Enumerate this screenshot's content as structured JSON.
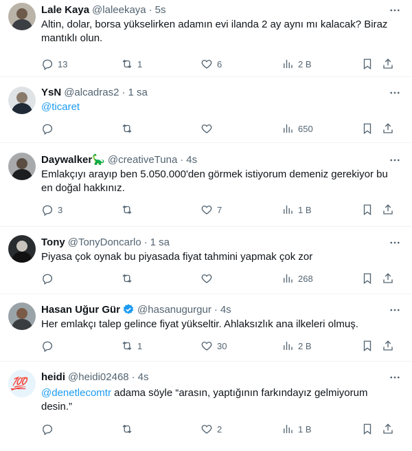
{
  "tweets": [
    {
      "name": "Lale Kaya",
      "handle": "@laleekaya",
      "sep": "·",
      "time": "5s",
      "text": "Altin, dolar, borsa yükselirken adamın evi ilanda 2 ay aynı mı kalacak? Biraz mantıklı olun.",
      "replies": "13",
      "retweets": "1",
      "likes": "6",
      "views": "2 B"
    },
    {
      "name": "YsN",
      "handle": "@alcadras2",
      "sep": "·",
      "time": "1 sa",
      "text": "@ticaret",
      "replies": "",
      "retweets": "",
      "likes": "",
      "views": "650"
    },
    {
      "name": "Daywalker🦕",
      "handle": "@creativeTuna",
      "sep": "·",
      "time": "4s",
      "text": "Emlakçıyı arayıp ben 5.050.000'den  görmek istiyorum demeniz gerekiyor bu en doğal hakkınız.",
      "replies": "3",
      "retweets": "",
      "likes": "7",
      "views": "1 B"
    },
    {
      "name": "Tony",
      "handle": "@TonyDoncarlo",
      "sep": "·",
      "time": "1 sa",
      "text": "Piyasa çok oynak bu piyasada fiyat tahmini yapmak çok zor",
      "replies": "",
      "retweets": "",
      "likes": "",
      "views": "268"
    },
    {
      "name": "Hasan Uğur Gür",
      "handle": "@hasanugurgur",
      "sep": "·",
      "time": "4s",
      "text": "Her emlakçı talep gelince fiyat yükseltir. Ahlaksızlık ana ilkeleri olmuş.",
      "replies": "",
      "retweets": "1",
      "likes": "30",
      "views": "2 B"
    },
    {
      "name": "heidi",
      "handle": "@heidi02468",
      "sep": "·",
      "time": "4s",
      "mention": "@denetlecomtr",
      "text": " adama söyle “arasın, yaptığının farkındayız gelmiyorum desin.”",
      "replies": "",
      "retweets": "",
      "likes": "2",
      "views": "1 B"
    }
  ],
  "icons": {
    "reply": "reply-icon",
    "retweet": "retweet-icon",
    "like": "heart-icon",
    "views": "views-icon",
    "bookmark": "bookmark-icon",
    "share": "share-icon",
    "more": "more-icon",
    "verified": "verified-badge-icon"
  },
  "colors": {
    "link": "#1d9bf0",
    "text": "#0f1419",
    "secondary": "#536471",
    "divider": "#eff3f4"
  }
}
